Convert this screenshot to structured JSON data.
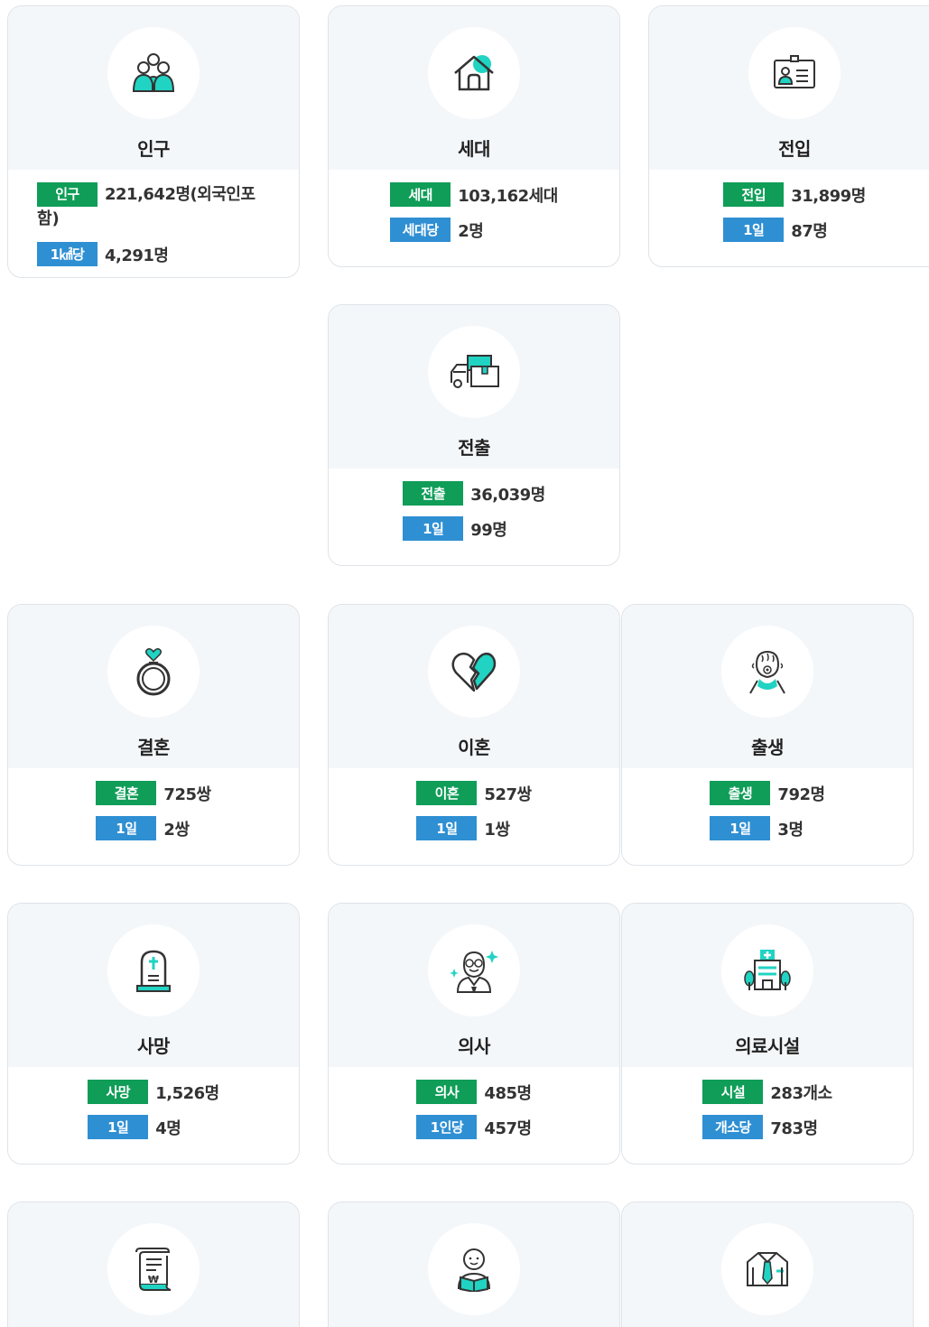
{
  "cards": {
    "population": {
      "title": "인구",
      "tag1": "인구",
      "val1": "221,642명(외국인포",
      "val1b": "함)",
      "tag2": "1㎢당",
      "val2": "4,291명"
    },
    "household": {
      "title": "세대",
      "tag1": "세대",
      "val1": "103,162세대",
      "tag2": "세대당",
      "val2": "2명"
    },
    "movein": {
      "title": "전입",
      "tag1": "전입",
      "val1": "31,899명",
      "tag2": "1일",
      "val2": "87명"
    },
    "moveout": {
      "title": "전출",
      "tag1": "전출",
      "val1": "36,039명",
      "tag2": "1일",
      "val2": "99명"
    },
    "marriage": {
      "title": "결혼",
      "tag1": "결혼",
      "val1": "725쌍",
      "tag2": "1일",
      "val2": "2쌍"
    },
    "divorce": {
      "title": "이혼",
      "tag1": "이혼",
      "val1": "527쌍",
      "tag2": "1일",
      "val2": "1쌍"
    },
    "birth": {
      "title": "출생",
      "tag1": "출생",
      "val1": "792명",
      "tag2": "1일",
      "val2": "3명"
    },
    "death": {
      "title": "사망",
      "tag1": "사망",
      "val1": "1,526명",
      "tag2": "1일",
      "val2": "4명"
    },
    "doctor": {
      "title": "의사",
      "tag1": "의사",
      "val1": "485명",
      "tag2": "1인당",
      "val2": "457명"
    },
    "medical": {
      "title": "의료시설",
      "tag1": "시설",
      "val1": "283개소",
      "tag2": "개소당",
      "val2": "783명"
    }
  },
  "icons": [
    "people-icon",
    "house-icon",
    "id-card-icon",
    "truck-icon",
    "ring-icon",
    "broken-heart-icon",
    "baby-icon",
    "tombstone-icon",
    "doctor-icon",
    "hospital-icon",
    "bill-icon",
    "reader-icon",
    "shirt-icon"
  ],
  "colors": {
    "green": "#0f9d58",
    "blue": "#2f8fd3",
    "accent": "#20d3c2",
    "card_bg": "#f4f7fa"
  }
}
